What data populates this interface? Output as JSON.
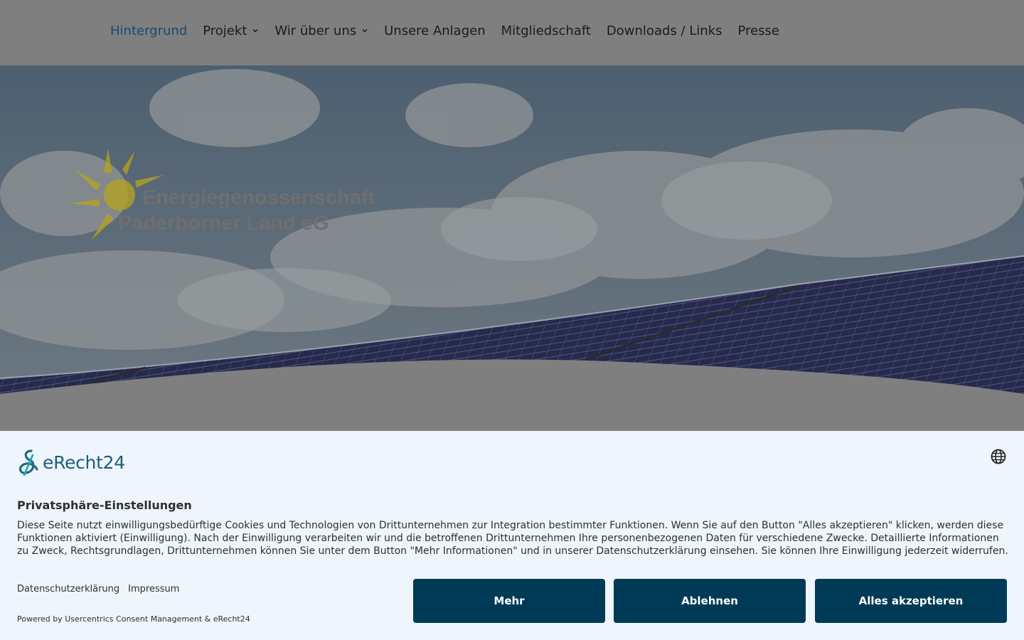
{
  "nav": {
    "items": [
      {
        "label": "Hintergrund",
        "active": true,
        "dropdown": false
      },
      {
        "label": "Projekt",
        "active": false,
        "dropdown": true
      },
      {
        "label": "Wir über uns",
        "active": false,
        "dropdown": true
      },
      {
        "label": "Unsere Anlagen",
        "active": false,
        "dropdown": false
      },
      {
        "label": "Mitgliedschaft",
        "active": false,
        "dropdown": false
      },
      {
        "label": "Downloads / Links",
        "active": false,
        "dropdown": false
      },
      {
        "label": "Presse",
        "active": false,
        "dropdown": false
      }
    ]
  },
  "hero": {
    "logo_line1": "Energiegenossenschaft",
    "logo_line2": "Paderborner Land eG"
  },
  "consent": {
    "brand": "eRecht24",
    "title": "Privatsphäre-Einstellungen",
    "body": "Diese Seite nutzt einwilligungsbedürftige Cookies und Technologien von Drittunternehmen zur Integration bestimmter Funktionen. Wenn Sie auf den Button \"Alles akzeptieren\" klicken, werden diese Funktionen aktiviert (Einwilligung). Nach der Einwilligung verarbeiten wir und die betroffenen Drittunternehmen Ihre personenbezogenen Daten für verschiedene Zwecke. Detaillierte Informationen zu Zweck, Rechtsgrundlagen, Drittunternehmen können Sie unter dem Button \"Mehr Informationen\" und in unserer Datenschutzerklärung einsehen. Sie können Ihre Einwilligung jederzeit widerrufen.",
    "link_privacy": "Datenschutzerklärung",
    "link_imprint": "Impressum",
    "powered": "Powered by Usercentrics Consent Management & eRecht24",
    "btn_more": "Mehr",
    "btn_deny": "Ablehnen",
    "btn_accept": "Alles akzeptieren"
  },
  "colors": {
    "nav_active": "#1b4a70",
    "button_bg": "#003a57",
    "consent_bg": "#eff5fd",
    "brand": "#1e5e78",
    "sun": "#b8a41c"
  },
  "icons": {
    "nav_dropdown": "chevron-down-icon",
    "language": "globe-icon",
    "brand": "erecht24-logo-icon",
    "sun": "sun-logo-icon"
  }
}
